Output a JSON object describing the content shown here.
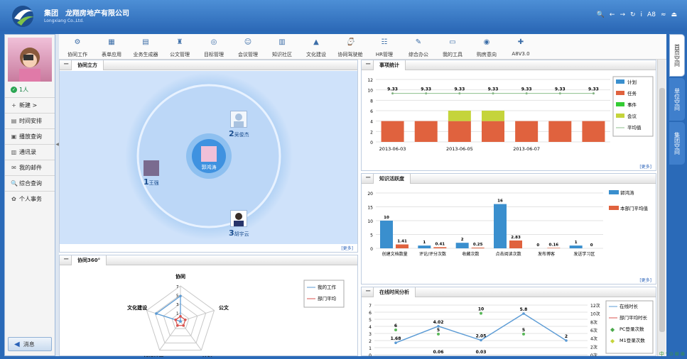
{
  "header": {
    "brand_line1": "集团　龙翔房地产有限公司",
    "brand_line2": "Longxiang Co.,Ltd.",
    "tools": [
      "🔍",
      "←",
      "→",
      "↻",
      "i",
      "A8",
      "≈",
      "⏏"
    ]
  },
  "user": {
    "online_count": "1人"
  },
  "left_menu": [
    {
      "label": "新建 >",
      "icon": "+"
    },
    {
      "label": "时间安排",
      "icon": "▤"
    },
    {
      "label": "播放查询",
      "icon": "▣"
    },
    {
      "label": "通讯录",
      "icon": "▥"
    },
    {
      "label": "我的邮件",
      "icon": "✉"
    },
    {
      "label": "综合查询",
      "icon": "🔍"
    },
    {
      "label": "个人事务",
      "icon": "✿"
    }
  ],
  "message_button": "消息",
  "toolbar": [
    {
      "label": "协同工作",
      "icon": "⚙"
    },
    {
      "label": "表单应用",
      "icon": "▦"
    },
    {
      "label": "业务生成器",
      "icon": "▤"
    },
    {
      "label": "公文管理",
      "icon": "♜"
    },
    {
      "label": "目标管理",
      "icon": "◎"
    },
    {
      "label": "会议管理",
      "icon": "☺"
    },
    {
      "label": "知识社区",
      "icon": "▥"
    },
    {
      "label": "文化建设",
      "icon": "▲"
    },
    {
      "label": "协同驾驶舱",
      "icon": "⌚"
    },
    {
      "label": "HR管理",
      "icon": "☷"
    },
    {
      "label": "综合办公",
      "icon": "✎"
    },
    {
      "label": "我的工具",
      "icon": "▭"
    },
    {
      "label": "购房意向",
      "icon": "◉"
    },
    {
      "label": "A8V3.0",
      "icon": "✚"
    }
  ],
  "panels": {
    "cube": "协同立方",
    "stat": "事项统计",
    "k360": "协同360°",
    "know": "知识活跃度",
    "online": "在线时间分析",
    "more": "[更多]"
  },
  "cube": {
    "center": "郭鸿涛",
    "p1_num": "1",
    "p1_name": "王强",
    "p2_num": "2",
    "p2_name": "吴俊杰",
    "p3_num": "3",
    "p3_name": "胡宇云"
  },
  "colors": {
    "plan": "#3a8fce",
    "task": "#e0623e",
    "event": "#33cc33",
    "meeting": "#c5d43b",
    "avg": "#8cbf8c",
    "line": "#5b9bd5",
    "red": "#d9534f"
  },
  "chart_data": [
    {
      "type": "bar",
      "title": "事项统计",
      "categories": [
        "2013-06-03",
        "",
        "2013-06-05",
        "",
        "2013-06-07",
        "",
        ""
      ],
      "xticks": [
        "2013-06-03",
        "2013-06-05",
        "2013-06-07"
      ],
      "ylim": [
        0,
        12
      ],
      "yticks": [
        0,
        2,
        4,
        6,
        8,
        10,
        12
      ],
      "series": [
        {
          "name": "计划",
          "values": [
            0,
            0,
            0,
            0,
            0,
            0,
            0
          ]
        },
        {
          "name": "任务",
          "values": [
            4,
            4,
            4,
            4,
            4,
            4,
            4
          ]
        },
        {
          "name": "事件",
          "values": [
            0,
            0,
            0,
            0,
            0,
            0,
            0
          ]
        },
        {
          "name": "会议",
          "values": [
            0,
            0,
            2,
            2,
            0,
            0,
            0
          ]
        },
        {
          "name": "平均值",
          "values": [
            9.33,
            9.33,
            9.33,
            9.33,
            9.33,
            9.33,
            9.33
          ]
        }
      ],
      "point_labels": [
        "9.33",
        "9.33",
        "9.33",
        "9.33",
        "9.33",
        "9.33",
        "9.33"
      ]
    },
    {
      "type": "bar",
      "title": "知识活跃度",
      "categories": [
        "创建文档数量",
        "评论/评分次数",
        "收藏次数",
        "点击阅读次数",
        "发布博客",
        "发送学习区"
      ],
      "ylim": [
        0,
        20
      ],
      "yticks": [
        0,
        5,
        10,
        15,
        20
      ],
      "series": [
        {
          "name": "郭鸿涛",
          "values": [
            10,
            1,
            2,
            16,
            0,
            1
          ],
          "labels": [
            "10",
            "1",
            "2",
            "16",
            "0",
            "1"
          ]
        },
        {
          "name": "本部门平均值",
          "values": [
            1.41,
            0.41,
            0.25,
            2.83,
            0.16,
            0
          ],
          "labels": [
            "1.41",
            "0.41",
            "0.25",
            "2.83",
            "0.16",
            "0"
          ]
        }
      ]
    },
    {
      "type": "radar",
      "title": "协同360°",
      "axes": [
        "协同",
        "公文",
        "计划",
        "知识社区",
        "文化建设"
      ],
      "series": [
        {
          "name": "我的工作",
          "values": [
            5,
            0,
            0,
            0,
            5
          ]
        },
        {
          "name": "部门平均",
          "values": [
            1,
            1,
            1,
            1,
            1
          ]
        }
      ],
      "ticks": [
        "1",
        "3",
        "5",
        "7"
      ]
    },
    {
      "type": "line",
      "title": "在线时间分析",
      "ylim": [
        0,
        7
      ],
      "yticks": [
        0,
        1,
        2,
        3,
        4,
        5,
        6,
        7
      ],
      "y2ticks": [
        "0次",
        "2次",
        "4次",
        "6次",
        "8次",
        "10次",
        "12次"
      ],
      "series": [
        {
          "name": "在线时长",
          "values": [
            1.68,
            4.02,
            2.05,
            5.8,
            2
          ],
          "labels": [
            "1.68",
            "4.02",
            "2.05",
            "5.8",
            "2"
          ]
        },
        {
          "name": "部门平均时长",
          "values": [
            0.06,
            0.06,
            0.03,
            0,
            0
          ]
        },
        {
          "name": "PC登录次数",
          "values": [
            6,
            5,
            10,
            5,
            null
          ],
          "labels": [
            "6",
            "5",
            "10",
            "5",
            ""
          ]
        },
        {
          "name": "M1登录次数",
          "values": [
            null,
            null,
            null,
            null,
            null
          ]
        }
      ],
      "low_labels": [
        "0.06",
        "0.03"
      ]
    }
  ],
  "right_tabs": [
    "首页空间",
    "单位空间",
    "集团空间"
  ],
  "tray": "中 ᶜ ⊙ ⊞ ⊞"
}
